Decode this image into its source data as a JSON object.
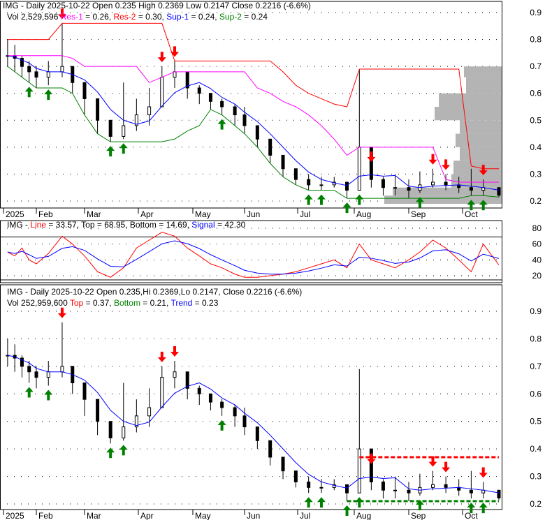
{
  "chart_data": {
    "type": "candlestick",
    "ticker": "IMG",
    "panel1": {
      "title": "IMG - Daily 2025-10-22 Open 0.235  High 0.2369  Low 0.2147  Close 0.2216 (-6.6%)",
      "vol_text": "Vol 2,529,596",
      "res1_label": "Res-1",
      "res1_value": " = 0.26, ",
      "res2_label": "Res-2",
      "res2_value": " = 0.30, ",
      "sup1_label": "Sup-1",
      "sup1_value": " = 0.24, ",
      "sup2_label": "Sup-2",
      "sup2_value": " = 0.24",
      "yticks": [
        "0.9",
        "0.8",
        "0.7",
        "0.6",
        "0.5",
        "0.4",
        "0.3",
        "0.2"
      ],
      "ylim": [
        0.2,
        0.9
      ]
    },
    "panel2": {
      "prefix": "IMG - ",
      "line_label": "Line",
      "line_value": " = 33.57, Top = 68.95, Bottom = 14.69, ",
      "signal_label": "Signal",
      "signal_value": " = 42.30",
      "yticks": [
        "80",
        "60",
        "40",
        "20"
      ],
      "ylim": [
        20,
        80
      ],
      "top": 68.95,
      "bottom": 14.69
    },
    "panel3": {
      "title": "IMG - Daily 2025-10-22 Open 0.235,Hi 0.2369,Lo 0.2147, Close 0.2216 (-6.6%)",
      "vol_text": "Vol 252,959,600 ",
      "top_label": "Top",
      "top_value": " = 0.37, ",
      "bottom_label": "Bottom",
      "bottom_value": " = 0.21, ",
      "trend_label": "Trend",
      "trend_value": " = 0.23",
      "yticks": [
        "0.9",
        "0.8",
        "0.7",
        "0.6",
        "0.5",
        "0.4",
        "0.3",
        "0.2"
      ],
      "ylim": [
        0.2,
        0.9
      ],
      "top": 0.37,
      "bottom": 0.21
    },
    "xticks": [
      "2025",
      "Feb",
      "Mar",
      "Apr",
      "May",
      "Jun",
      "Jul",
      "Aug",
      "Sep",
      "Oct"
    ],
    "dates": [
      "01-06",
      "01-13",
      "01-20",
      "01-27",
      "02-03",
      "02-10",
      "02-18",
      "02-24",
      "03-03",
      "03-10",
      "03-17",
      "03-24",
      "03-31",
      "04-07",
      "04-14",
      "04-21",
      "04-28",
      "05-05",
      "05-12",
      "05-19",
      "05-27",
      "06-02",
      "06-09",
      "06-16",
      "06-23",
      "06-30",
      "07-07",
      "07-14",
      "07-21",
      "07-28",
      "08-04",
      "08-11",
      "08-18",
      "08-25",
      "09-02",
      "09-08",
      "09-15",
      "09-22",
      "09-29",
      "10-06",
      "10-13",
      "10-22"
    ],
    "close": [
      0.74,
      0.73,
      0.7,
      0.68,
      0.66,
      0.68,
      0.7,
      0.64,
      0.58,
      0.5,
      0.44,
      0.48,
      0.52,
      0.55,
      0.66,
      0.68,
      0.62,
      0.6,
      0.57,
      0.55,
      0.52,
      0.48,
      0.43,
      0.37,
      0.32,
      0.28,
      0.26,
      0.26,
      0.27,
      0.24,
      0.4,
      0.28,
      0.25,
      0.25,
      0.24,
      0.26,
      0.27,
      0.26,
      0.25,
      0.24,
      0.25,
      0.2216
    ],
    "high": [
      0.8,
      0.78,
      0.74,
      0.72,
      0.7,
      0.72,
      0.86,
      0.7,
      0.62,
      0.58,
      0.5,
      0.64,
      0.58,
      0.62,
      0.7,
      0.72,
      0.68,
      0.63,
      0.6,
      0.58,
      0.56,
      0.55,
      0.47,
      0.42,
      0.36,
      0.31,
      0.3,
      0.29,
      0.29,
      0.27,
      0.69,
      0.33,
      0.29,
      0.3,
      0.28,
      0.31,
      0.32,
      0.3,
      0.29,
      0.32,
      0.28,
      0.2369
    ],
    "low": [
      0.7,
      0.68,
      0.66,
      0.64,
      0.62,
      0.63,
      0.66,
      0.6,
      0.52,
      0.45,
      0.42,
      0.43,
      0.46,
      0.48,
      0.57,
      0.62,
      0.58,
      0.56,
      0.54,
      0.52,
      0.48,
      0.45,
      0.4,
      0.34,
      0.29,
      0.26,
      0.24,
      0.24,
      0.25,
      0.21,
      0.24,
      0.25,
      0.22,
      0.22,
      0.21,
      0.23,
      0.25,
      0.24,
      0.23,
      0.22,
      0.22,
      0.2147
    ],
    "oscillator": [
      50,
      45,
      55,
      40,
      35,
      48,
      70,
      60,
      45,
      25,
      18,
      30,
      55,
      65,
      75,
      70,
      55,
      45,
      35,
      30,
      22,
      18,
      18,
      20,
      22,
      25,
      30,
      35,
      40,
      30,
      60,
      40,
      35,
      30,
      40,
      50,
      65,
      55,
      40,
      25,
      60,
      33.57
    ],
    "buy_signals": [
      "01-27",
      "02-10",
      "03-17",
      "03-24",
      "05-19",
      "07-07",
      "07-14",
      "07-28",
      "08-04",
      "09-08",
      "10-06",
      "10-13"
    ],
    "sell_signals": [
      "02-18",
      "04-14",
      "04-21",
      "08-11",
      "09-15",
      "09-22",
      "10-13"
    ],
    "colors": {
      "res1": "#ff00ff",
      "res2": "#ff0000",
      "sup1": "#0000ff",
      "sup2": "#008000",
      "buy": "#008000",
      "sell": "#ff0000",
      "ma": "#0000ff",
      "volprofile": "#b4b4b4"
    }
  }
}
